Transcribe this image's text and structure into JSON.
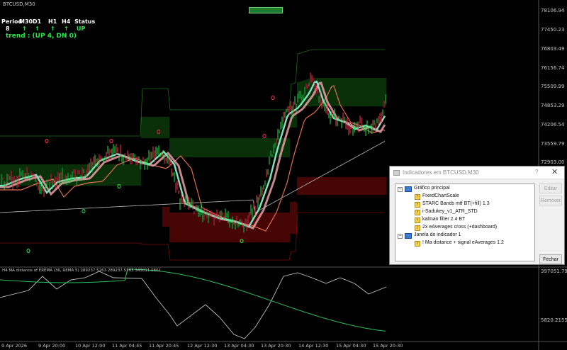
{
  "symbol": "BTCUSD,M30",
  "top_badge": "",
  "dashboard": {
    "headers": [
      "Period",
      "M30",
      "D1",
      "H1",
      "H4",
      "Status"
    ],
    "period_value": "8",
    "arrow_glyph": "↑",
    "status_value": "UP",
    "trend_text": "trend : (UP 4, DN 0)"
  },
  "price_axis": [
    "78106.94",
    "77450.23",
    "76803.49",
    "76156.74",
    "75509.99",
    "74853.29",
    "74206.54",
    "73559.79",
    "72903.00"
  ],
  "subwindow": {
    "title": "H4 MA distance of EREMA (36, REMA 5) 289237.5263 289237.5263 343011.0661",
    "top_value": "397051.796",
    "bottom_value": "5820.2155"
  },
  "time_axis": [
    "9 Apr 2026",
    "9 Apr 20:00",
    "10 Apr 12:00",
    "11 Apr 04:45",
    "11 Apr 20:45",
    "12 Apr 12:30",
    "13 Apr 04:30",
    "13 Apr 20:30",
    "14 Apr 12:30",
    "15 Apr 04:30",
    "15 Apr 20:30"
  ],
  "colors": {
    "bull_candle": "#21e84a",
    "bear_candle": "#ff3050",
    "upper_band": "#1f8a1f",
    "lower_band": "#b01010",
    "ema_fast": "#7fe0c0",
    "ema_slow": "#e07050",
    "ma_curve": "#e6a0a8"
  },
  "dialog": {
    "title": "Indicadores em BTCUSD,M30",
    "help": "?",
    "close": "✕",
    "tree": {
      "main_group": "Gráfico principal",
      "main_items": [
        "FixedChartScale",
        "STARC Bands mtf BT(+fill) 1.3",
        "i-Sadukey_v1_ATR_STD",
        "kalman filter 2.4 BT",
        "2x eAverages cross (+dashboard)"
      ],
      "sub_group": "Janela do indicador 1",
      "sub_items": [
        "! Ma distance + signal eAverages 1.2"
      ]
    },
    "buttons": {
      "edit": "Editar",
      "remove": "Remover",
      "close": "Fechar"
    }
  }
}
